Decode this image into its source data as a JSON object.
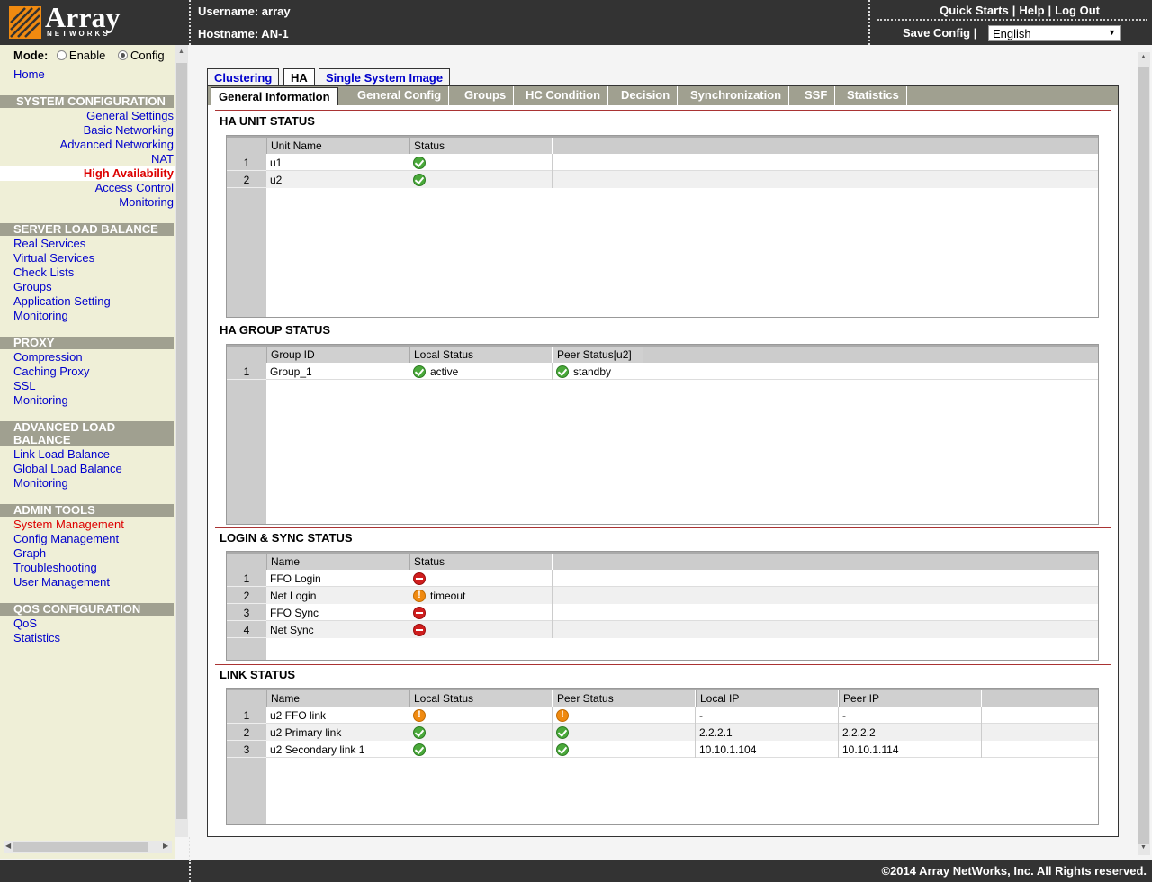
{
  "brand": {
    "name": "Array",
    "sub": "NETWORKS"
  },
  "header": {
    "username": "Username: array",
    "hostname": "Hostname: AN-1",
    "links": [
      "Quick Starts",
      "Help",
      "Log Out"
    ],
    "save_config": "Save Config |",
    "language": "English"
  },
  "sidebar": {
    "mode_label": "Mode:",
    "mode_enable": "Enable",
    "mode_config": "Config",
    "home": "Home",
    "sections": [
      {
        "title": "SYSTEM CONFIGURATION",
        "items": [
          "General Settings",
          "Basic Networking",
          "Advanced Networking",
          "NAT",
          "High Availability",
          "Access Control",
          "Monitoring"
        ]
      },
      {
        "title": "SERVER LOAD BALANCE",
        "items": [
          "Real Services",
          "Virtual Services",
          "Check Lists",
          "Groups",
          "Application Setting",
          "Monitoring"
        ]
      },
      {
        "title": "PROXY",
        "items": [
          "Compression",
          "Caching Proxy",
          "SSL",
          "Monitoring"
        ]
      },
      {
        "title": "ADVANCED LOAD BALANCE",
        "items": [
          "Link Load Balance",
          "Global Load Balance",
          "Monitoring"
        ]
      },
      {
        "title": "ADMIN TOOLS",
        "items": [
          "System Management",
          "Config Management",
          "Graph",
          "Troubleshooting",
          "User Management"
        ]
      },
      {
        "title": "QOS CONFIGURATION",
        "items": [
          "QoS",
          "Statistics"
        ]
      }
    ]
  },
  "tabs": [
    "Clustering",
    "HA",
    "Single System Image"
  ],
  "subtabs": [
    "General Information",
    "General Config",
    "Groups",
    "HC Condition",
    "Decision",
    "Synchronization",
    "SSF",
    "Statistics"
  ],
  "unit_status": {
    "title": "HA UNIT STATUS",
    "headers": [
      "Unit Name",
      "Status"
    ],
    "rows": [
      [
        "1",
        "u1",
        "ok"
      ],
      [
        "2",
        "u2",
        "ok"
      ]
    ]
  },
  "group_status": {
    "title": "HA GROUP STATUS",
    "headers": [
      "Group ID",
      "Local Status",
      "Peer Status[u2]"
    ],
    "rows": [
      [
        "1",
        "Group_1",
        "active",
        "standby"
      ]
    ]
  },
  "login_sync": {
    "title": "LOGIN & SYNC STATUS",
    "headers": [
      "Name",
      "Status"
    ],
    "rows": [
      [
        "1",
        "FFO Login",
        "err",
        ""
      ],
      [
        "2",
        "Net Login",
        "warn",
        "timeout"
      ],
      [
        "3",
        "FFO Sync",
        "err",
        ""
      ],
      [
        "4",
        "Net Sync",
        "err",
        ""
      ]
    ]
  },
  "link_status": {
    "title": "LINK STATUS",
    "headers": [
      "Name",
      "Local Status",
      "Peer Status",
      "Local IP",
      "Peer IP"
    ],
    "rows": [
      [
        "1",
        "u2 FFO link",
        "warn",
        "warn",
        "-",
        "-"
      ],
      [
        "2",
        "u2 Primary link",
        "ok",
        "ok",
        "2.2.2.1",
        "2.2.2.2"
      ],
      [
        "3",
        "u2 Secondary link 1",
        "ok",
        "ok",
        "10.10.1.104",
        "10.10.1.114"
      ]
    ]
  },
  "footer": "©2014 Array NetWorks, Inc. All Rights reserved."
}
